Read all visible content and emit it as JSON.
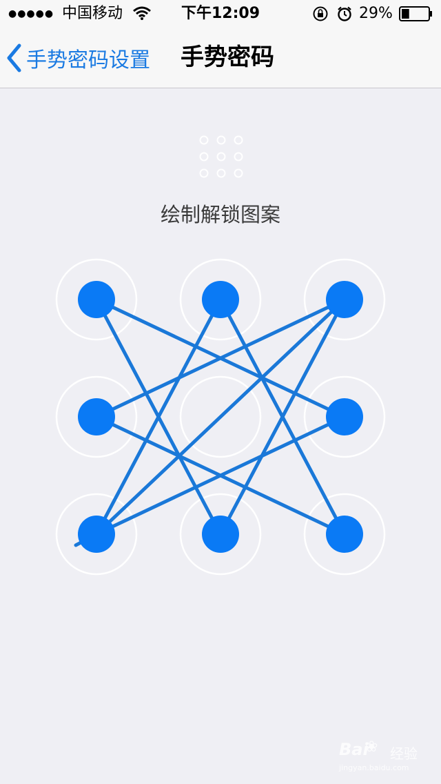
{
  "status_bar": {
    "signal": "●●●●●",
    "carrier": "中国移动",
    "time": "下午12:09",
    "battery": "29%",
    "battery_level": 0.29
  },
  "nav": {
    "back_label": "手势密码设置",
    "title": "手势密码"
  },
  "prompt": "绘制解锁图案",
  "pattern": {
    "selected_nodes": [
      0,
      1,
      2,
      3,
      5,
      6,
      7,
      8
    ],
    "path": [
      6,
      2,
      3,
      8,
      1,
      6,
      5,
      0,
      7,
      2
    ]
  },
  "watermark": {
    "logo": "Bai",
    "name": "经验",
    "url": "jingyan.baidu.com"
  },
  "colors": {
    "accent": "#1a7ae2",
    "node_fill": "#0a7af5",
    "line": "#1a78d8",
    "background": "#efeff4",
    "bar": "#f7f7f7"
  }
}
